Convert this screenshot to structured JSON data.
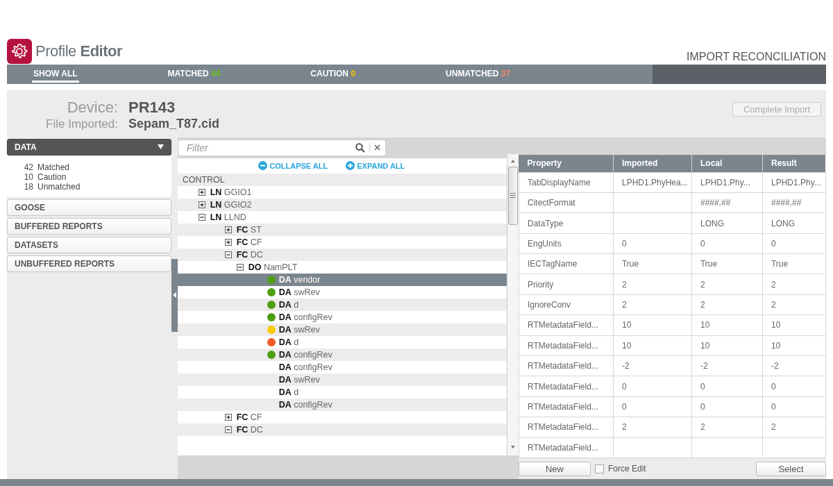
{
  "app": {
    "title": "Profile **Editor**",
    "section": "IMPORT RECONCILIATION"
  },
  "nav_tabs": [
    {
      "label": "SHOW ALL",
      "selected": true
    },
    {
      "label": "MATCHED",
      "count": "44",
      "color": "#66c21a",
      "selected": false
    },
    {
      "label": "CAUTION",
      "count": "0",
      "color": "#f5c400",
      "selected": false
    },
    {
      "label": "UNMATCHED",
      "count": "37",
      "color": "#f0876a",
      "selected": false
    }
  ],
  "device": {
    "label": "Device:",
    "value": "PR143"
  },
  "file": {
    "label": "File Imported:",
    "value": "Sepam_T87.cid"
  },
  "complete_button": {
    "label": "Complete Import",
    "disabled": true
  },
  "sections": [
    {
      "label": "DATA",
      "expanded": true
    },
    {
      "label": "GOOSE",
      "expanded": false
    },
    {
      "label": "BUFFERED REPORTS",
      "expanded": false
    },
    {
      "label": "DATASETS",
      "expanded": false
    },
    {
      "label": "UNBUFFERED REPORTS",
      "expanded": false
    }
  ],
  "summary": [
    {
      "count": "42",
      "label": "Matched"
    },
    {
      "count": "10",
      "label": "Caution"
    },
    {
      "count": "18",
      "label": "Unmatched"
    }
  ],
  "filter": {
    "placeholder": "Filter"
  },
  "tree_actions": [
    {
      "kind": "collapse",
      "label": "COLLAPSE ALL"
    },
    {
      "kind": "expand",
      "label": "EXPAND ALL"
    }
  ],
  "tree": [
    {
      "label": "CONTROL",
      "selected": false,
      "children": [
        {
          "label": "**LN** GGIO1",
          "expanded": false,
          "selected": false
        },
        {
          "label": "**LN** GGIO2",
          "expanded": false,
          "selected": false
        },
        {
          "label": "**LN** LLND",
          "expanded": true,
          "selected": false,
          "children": [
            {
              "label": "**FC** ST",
              "expanded": false,
              "selected": false
            },
            {
              "label": "**FC** CF",
              "expanded": false,
              "selected": false
            },
            {
              "label": "**FC** DC",
              "expanded": true,
              "selected": false,
              "children": [
                {
                  "label": "**DO** NamPLT",
                  "expanded": true,
                  "selected": false,
                  "children": [
                    {
                      "label": "**DA** vendor",
                      "color": "#4f9e12",
                      "selected": true
                    },
                    {
                      "label": "**DA** swRev",
                      "color": "#4f9e12",
                      "selected": false
                    },
                    {
                      "label": "**DA** d",
                      "color": "#4f9e12",
                      "selected": false
                    },
                    {
                      "label": "**DA** configRev",
                      "color": "#4f9e12",
                      "selected": false
                    },
                    {
                      "label": "**DA** swRev",
                      "color": "#f8cc00",
                      "selected": false
                    },
                    {
                      "label": "**DA** d",
                      "color": "#f05a28",
                      "selected": false
                    },
                    {
                      "label": "**DA** configRev",
                      "color": "#4f9e12",
                      "selected": false
                    },
                    {
                      "label": "**DA** configRev",
                      "selected": false
                    },
                    {
                      "label": "**DA** swRev",
                      "selected": false
                    },
                    {
                      "label": "**DA** d",
                      "selected": false
                    },
                    {
                      "label": "**DA** configRev",
                      "selected": false
                    }
                  ]
                }
              ]
            },
            {
              "label": "**FC** CF",
              "expanded": false,
              "selected": false
            },
            {
              "label": "**FC** DC",
              "expanded": true,
              "selected": false
            }
          ]
        }
      ]
    }
  ],
  "table": {
    "columns": [
      "Property",
      "Imported",
      "Local",
      "Result"
    ],
    "rows": [
      {
        "property": "TabDisplayName",
        "imported": "LPHD1.PhyHea...",
        "local": "LPHD1.Phy...",
        "result": "LPHD1.Phy..."
      },
      {
        "property": "CitectFormat",
        "local": "####.##",
        "result": "####.##"
      },
      {
        "property": "DataType",
        "local": "LONG",
        "result": "LONG"
      },
      {
        "property": "EngUnits",
        "imported": "0",
        "local": "0",
        "result": "0"
      },
      {
        "property": "IECTagName",
        "imported": "True",
        "local": "True",
        "result": "True"
      },
      {
        "property": "Priority",
        "imported": "2",
        "local": "2",
        "result": "2"
      },
      {
        "property": "IgnoreConv",
        "imported": "2",
        "local": "2",
        "result": "2"
      },
      {
        "property": "RTMetadataField...",
        "imported": "10",
        "local": "10",
        "result": "10"
      },
      {
        "property": "RTMetadataField...",
        "imported": "10",
        "local": "10",
        "result": "10"
      },
      {
        "property": "RTMetadataField...",
        "imported": "-2",
        "local": "-2",
        "result": "-2"
      },
      {
        "property": "RTMetadataField...",
        "imported": "0",
        "local": "0",
        "result": "0"
      },
      {
        "property": "RTMetadataField...",
        "imported": "0",
        "local": "0",
        "result": "0"
      },
      {
        "property": "RTMetadataField...",
        "imported": "2",
        "local": "2",
        "result": "2"
      },
      {
        "property": "RTMetadataField..."
      }
    ]
  },
  "new_button": {
    "label": "New"
  },
  "force_edit": {
    "label": "Force Edit",
    "checked": false
  },
  "select_button": {
    "label": "Select"
  }
}
